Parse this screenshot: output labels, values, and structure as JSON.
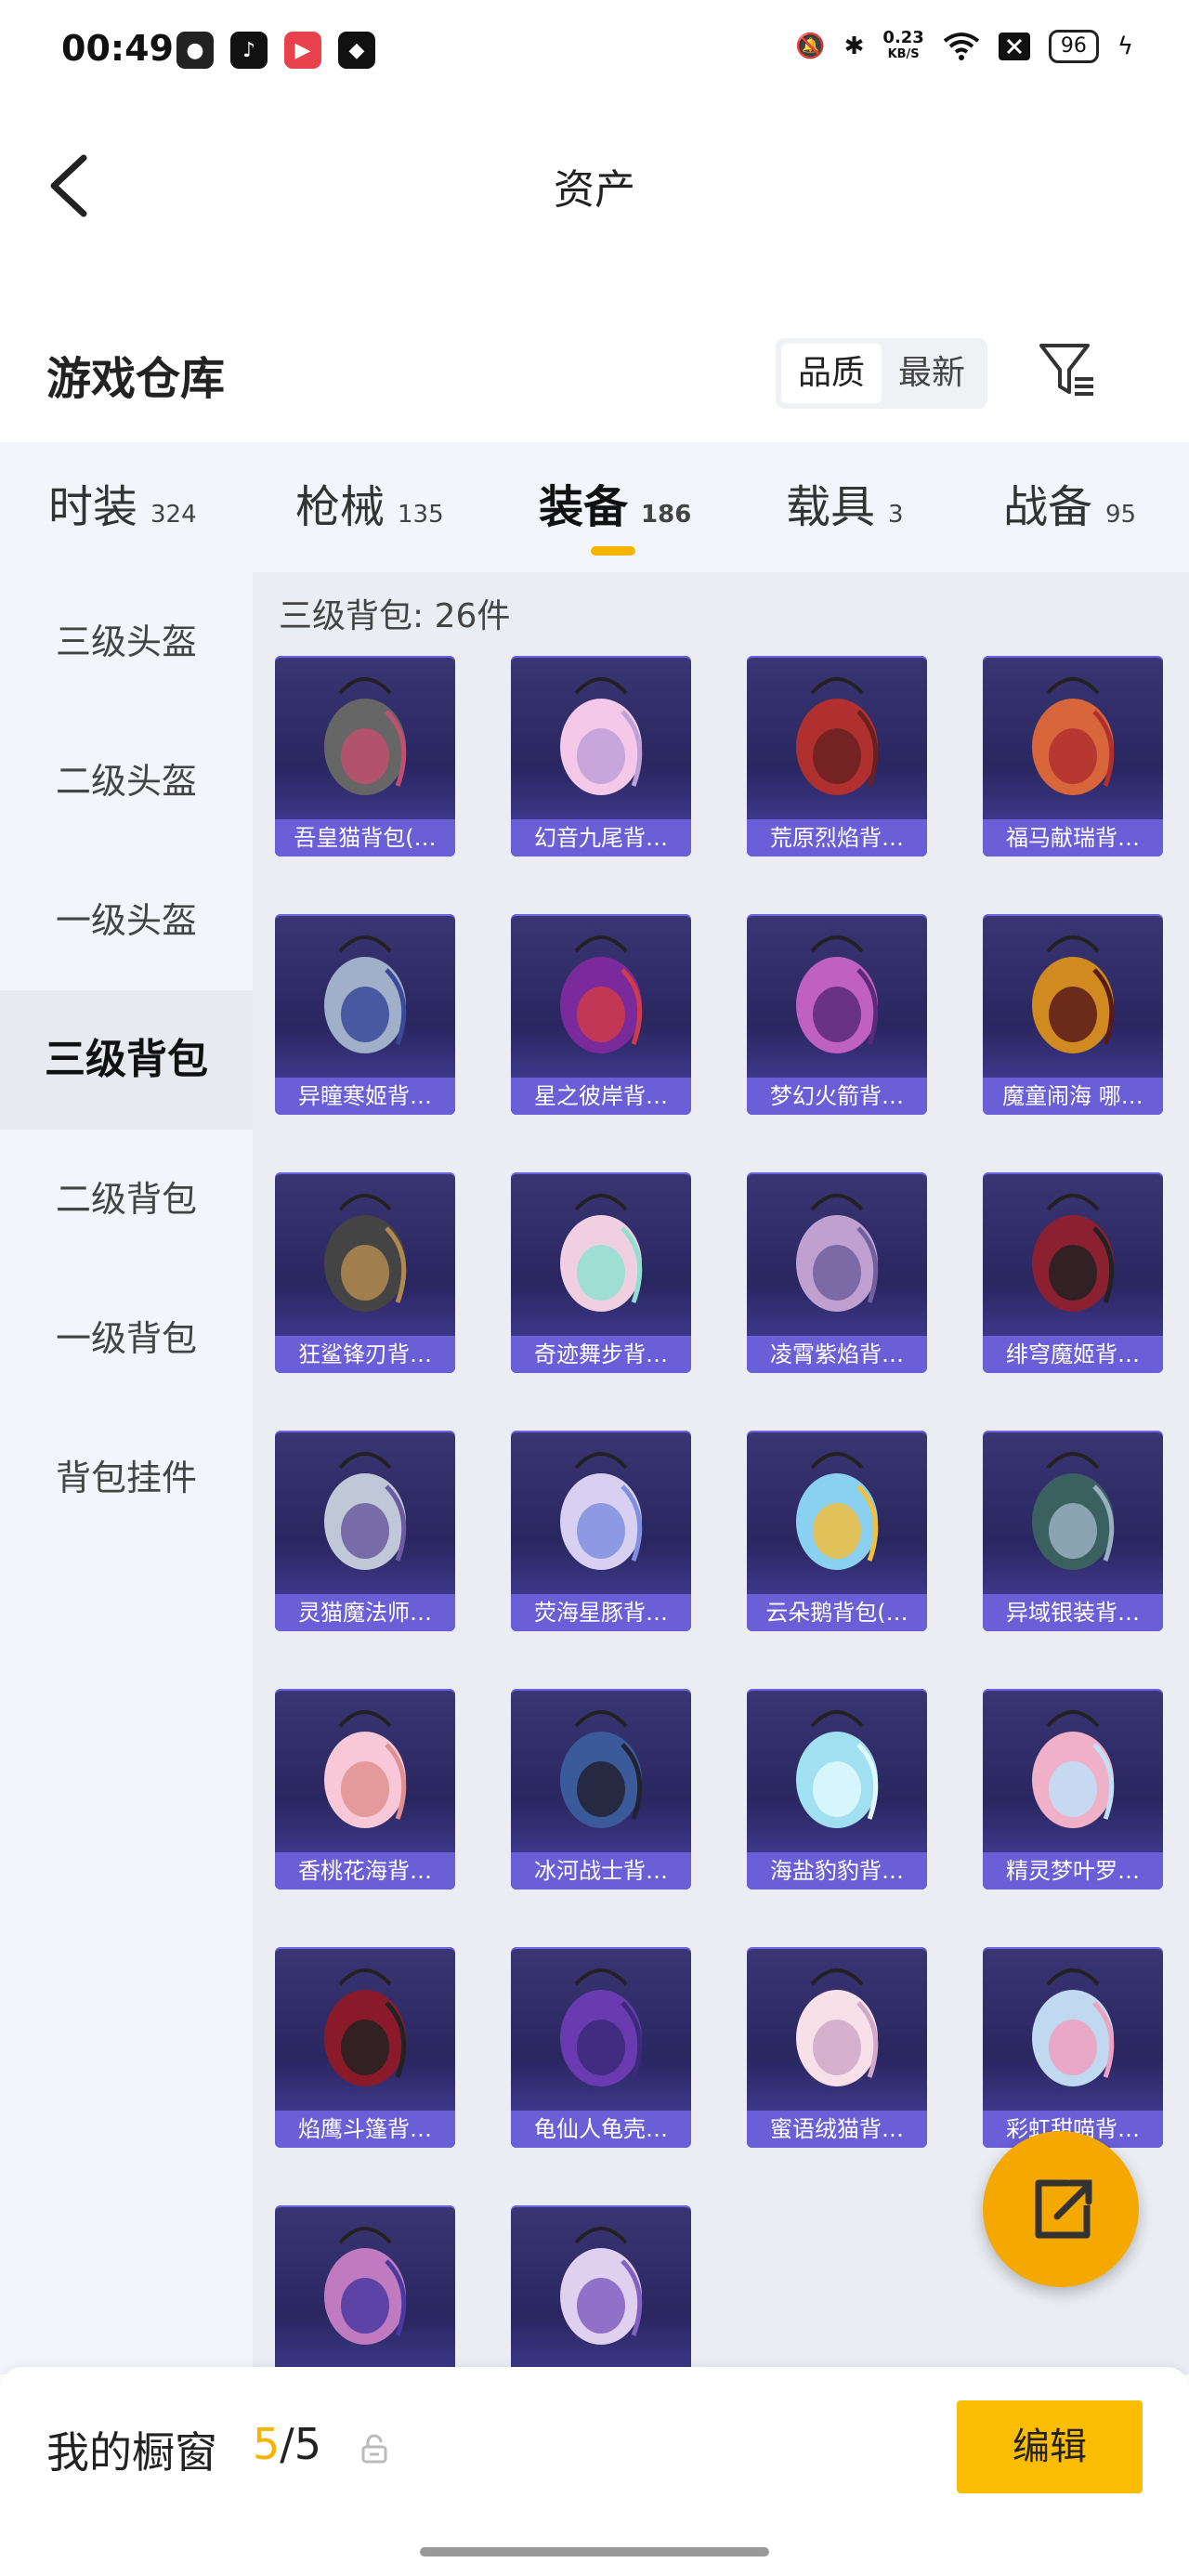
{
  "status_bar": {
    "time": "00:49",
    "net_speed_value": "0.23",
    "net_speed_unit": "KB/S",
    "battery": "96"
  },
  "header": {
    "title": "资产",
    "back_icon": "chevron-left-icon"
  },
  "section": {
    "title": "游戏仓库",
    "sort_options": [
      "品质",
      "最新"
    ],
    "sort_selected": "品质",
    "filter_icon": "filter-list-icon"
  },
  "tabs": [
    {
      "label": "时装",
      "count": "324"
    },
    {
      "label": "枪械",
      "count": "135"
    },
    {
      "label": "装备",
      "count": "186",
      "active": true
    },
    {
      "label": "载具",
      "count": "3"
    },
    {
      "label": "战备",
      "count": "95"
    }
  ],
  "sidebar": {
    "items": [
      "三级头盔",
      "二级头盔",
      "一级头盔",
      "三级背包",
      "二级背包",
      "一级背包",
      "背包挂件"
    ],
    "active": "三级背包"
  },
  "content": {
    "count_label": "三级背包: 26件",
    "items": [
      {
        "name": "吾皇猫背包(…"
      },
      {
        "name": "幻音九尾背…"
      },
      {
        "name": "荒原烈焰背…"
      },
      {
        "name": "福马献瑞背…"
      },
      {
        "name": "异瞳寒姬背…"
      },
      {
        "name": "星之彼岸背…"
      },
      {
        "name": "梦幻火箭背…"
      },
      {
        "name": "魔童闹海 哪…"
      },
      {
        "name": "狂鲨锋刃背…"
      },
      {
        "name": "奇迹舞步背…"
      },
      {
        "name": "凌霄紫焰背…"
      },
      {
        "name": "绯穹魔姬背…"
      },
      {
        "name": "灵猫魔法师…"
      },
      {
        "name": "荧海星豚背…"
      },
      {
        "name": "云朵鹅背包(…"
      },
      {
        "name": "异域银装背…"
      },
      {
        "name": "香桃花海背…"
      },
      {
        "name": "冰河战士背…"
      },
      {
        "name": "海盐豹豹背…"
      },
      {
        "name": "精灵梦叶罗…"
      },
      {
        "name": "焰鹰斗篷背…"
      },
      {
        "name": "龟仙人龟壳…"
      },
      {
        "name": "蜜语绒猫背…"
      },
      {
        "name": "彩虹甜喵背…"
      },
      {
        "name": ""
      },
      {
        "name": ""
      }
    ]
  },
  "fab": {
    "icon": "share-external-icon"
  },
  "bottom": {
    "showcase_label": "我的橱窗",
    "showcase_current": "5",
    "showcase_sep_total": "/5",
    "edit_label": "编辑"
  }
}
